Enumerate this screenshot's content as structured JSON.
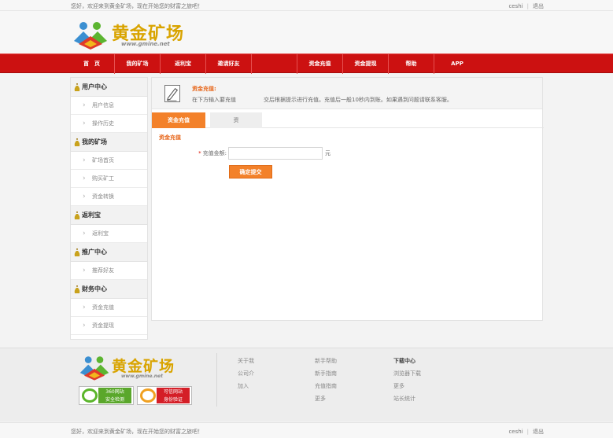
{
  "topbar": {
    "welcome": "您好，欢迎来到黄金矿场，现在开始您的财富之旅吧！",
    "username": "ceshi",
    "logout": "退出"
  },
  "logo": {
    "name": "黄金矿场",
    "url": "www.gmine.net"
  },
  "nav": {
    "items": [
      "首　页",
      "我的矿场",
      "返利宝",
      "邀请好友",
      "",
      "资金充值",
      "资金提现",
      "帮助",
      "APP"
    ]
  },
  "sidebar": {
    "groups": [
      {
        "title": "用户中心",
        "items": [
          "用户信息",
          "操作历史"
        ]
      },
      {
        "title": "我的矿场",
        "items": [
          "矿场首页",
          "购买矿工",
          "资金转换"
        ]
      },
      {
        "title": "返利宝",
        "items": [
          "返利宝"
        ]
      },
      {
        "title": "推广中心",
        "items": [
          "推荐好友"
        ]
      },
      {
        "title": "财务中心",
        "items": [
          "资金充值",
          "资金提现"
        ]
      }
    ]
  },
  "main": {
    "notice_title": "资金充值:",
    "notice_text": "在下方输入要充值　　　　　交后根据提示进行充值。充值后一般10秒内到账。如果遇到问题请联系客服。",
    "tabs": [
      "资金充值",
      "资"
    ],
    "section_title": "资金充值",
    "amount_label": "充值金额:",
    "amount_value": "",
    "unit": "元",
    "submit_label": "确定提交"
  },
  "footer": {
    "badges": [
      {
        "line1": "360网站",
        "line2": "安全检测"
      },
      {
        "line1": "可信网站",
        "line2": "身份验证"
      }
    ],
    "col1": [
      "关于我",
      "公司介",
      "加入"
    ],
    "col2": [
      "新手帮助",
      "新手指南",
      "充值指南",
      "更多"
    ],
    "col3": [
      "下载中心",
      "浏览器下载",
      "更多",
      "站长统计"
    ]
  },
  "colors": {
    "nav_red": "#cc1111",
    "accent_orange": "#f3812a",
    "logo_gold": "#d9a400"
  }
}
